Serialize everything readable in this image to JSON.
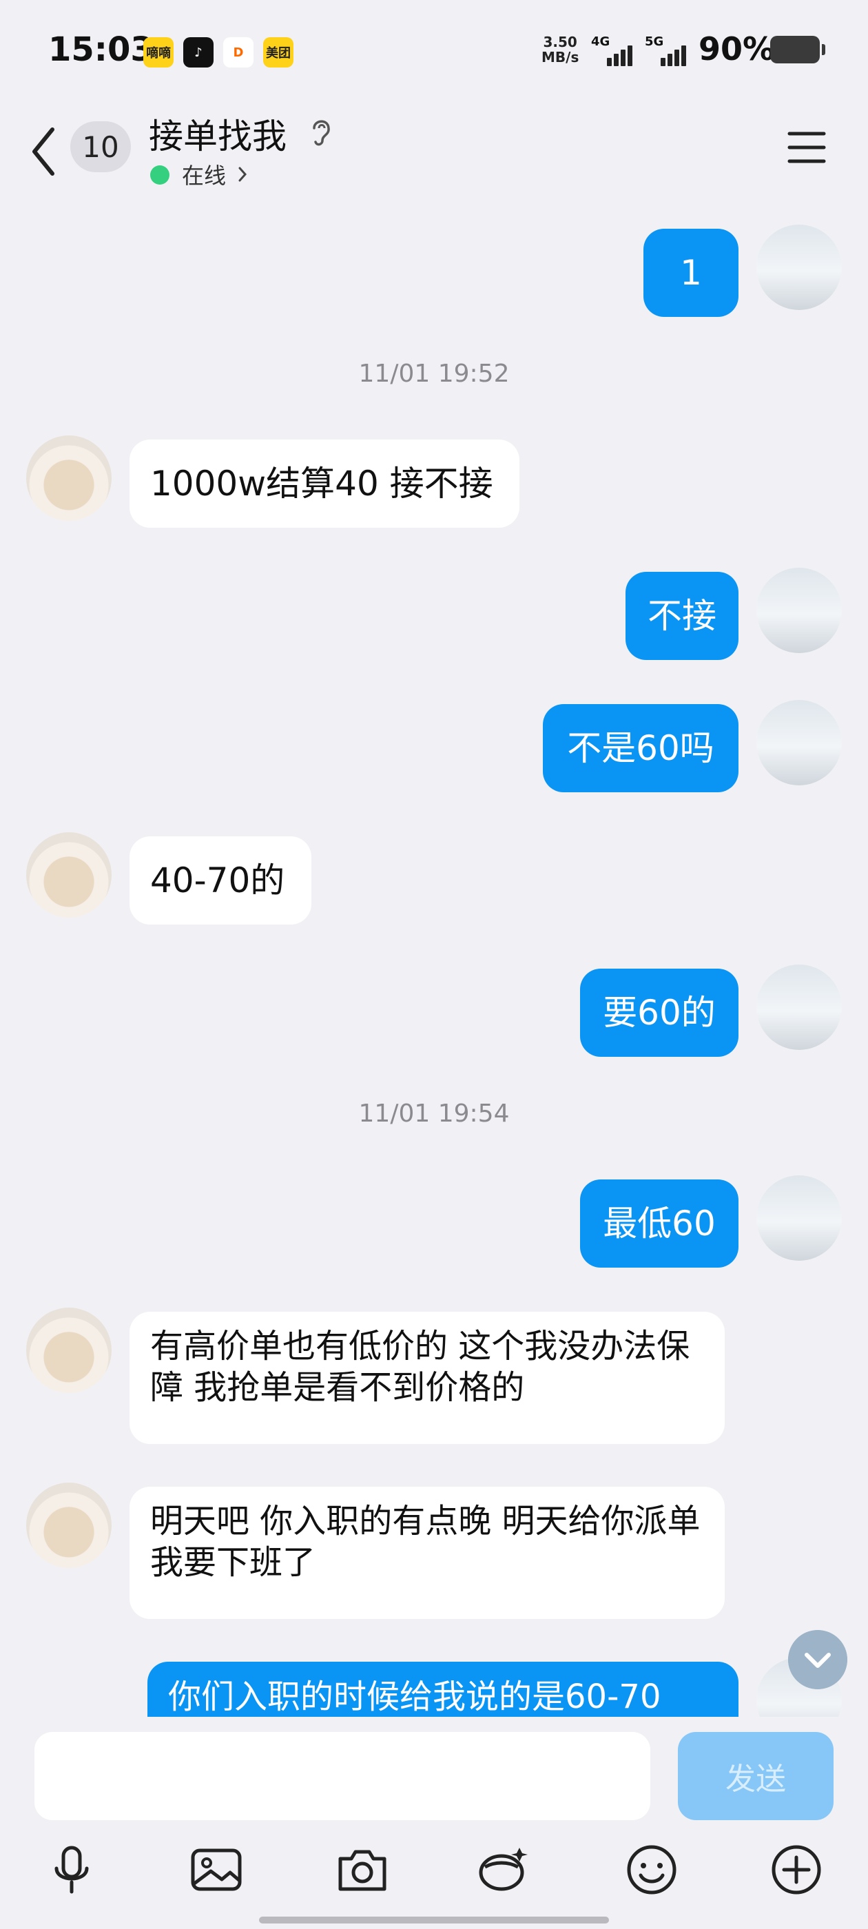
{
  "status_bar": {
    "time": "15:03",
    "apps": [
      {
        "name": "yellow-app-icon",
        "text": "嘀嘀",
        "bg": "#ffd21a",
        "fg": "#222"
      },
      {
        "name": "tiktok-icon",
        "text": "♪",
        "bg": "#111111",
        "fg": "#fff"
      },
      {
        "name": "didi-icon",
        "text": "D",
        "bg": "#ffffff",
        "fg": "#ff6a00"
      },
      {
        "name": "meituan-icon",
        "text": "美团",
        "bg": "#ffd21a",
        "fg": "#222"
      }
    ],
    "net_speed_value": "3.50",
    "net_speed_unit": "MB/s",
    "signal_1": "4G",
    "signal_2": "5G",
    "battery": "90%"
  },
  "header": {
    "unread_count": "10",
    "title": "接单找我",
    "status": "在线"
  },
  "messages": {
    "m1": "1",
    "ts1": "11/01 19:52",
    "m2": "1000w结算40 接不接",
    "m3": "不接",
    "m4": "不是60吗",
    "m5": "40-70的",
    "m6": "要60的",
    "ts2": "11/01 19:54",
    "m7": "最低60",
    "m8": "有高价单也有低价的 这个我没办法保障 我抢单是看不到价格的",
    "m9": "明天吧 你入职的有点晚 明天给你派单 我要下班了",
    "m10": "你们入职的时候给我说的是60-70"
  },
  "composer": {
    "input_value": "",
    "send_label": "发送"
  },
  "colors": {
    "outgoing_bubble": "#0a95f5",
    "incoming_bubble": "#ffffff",
    "background": "#f1f1f5",
    "send_disabled": "#86c7f7",
    "online": "#35d07f"
  }
}
